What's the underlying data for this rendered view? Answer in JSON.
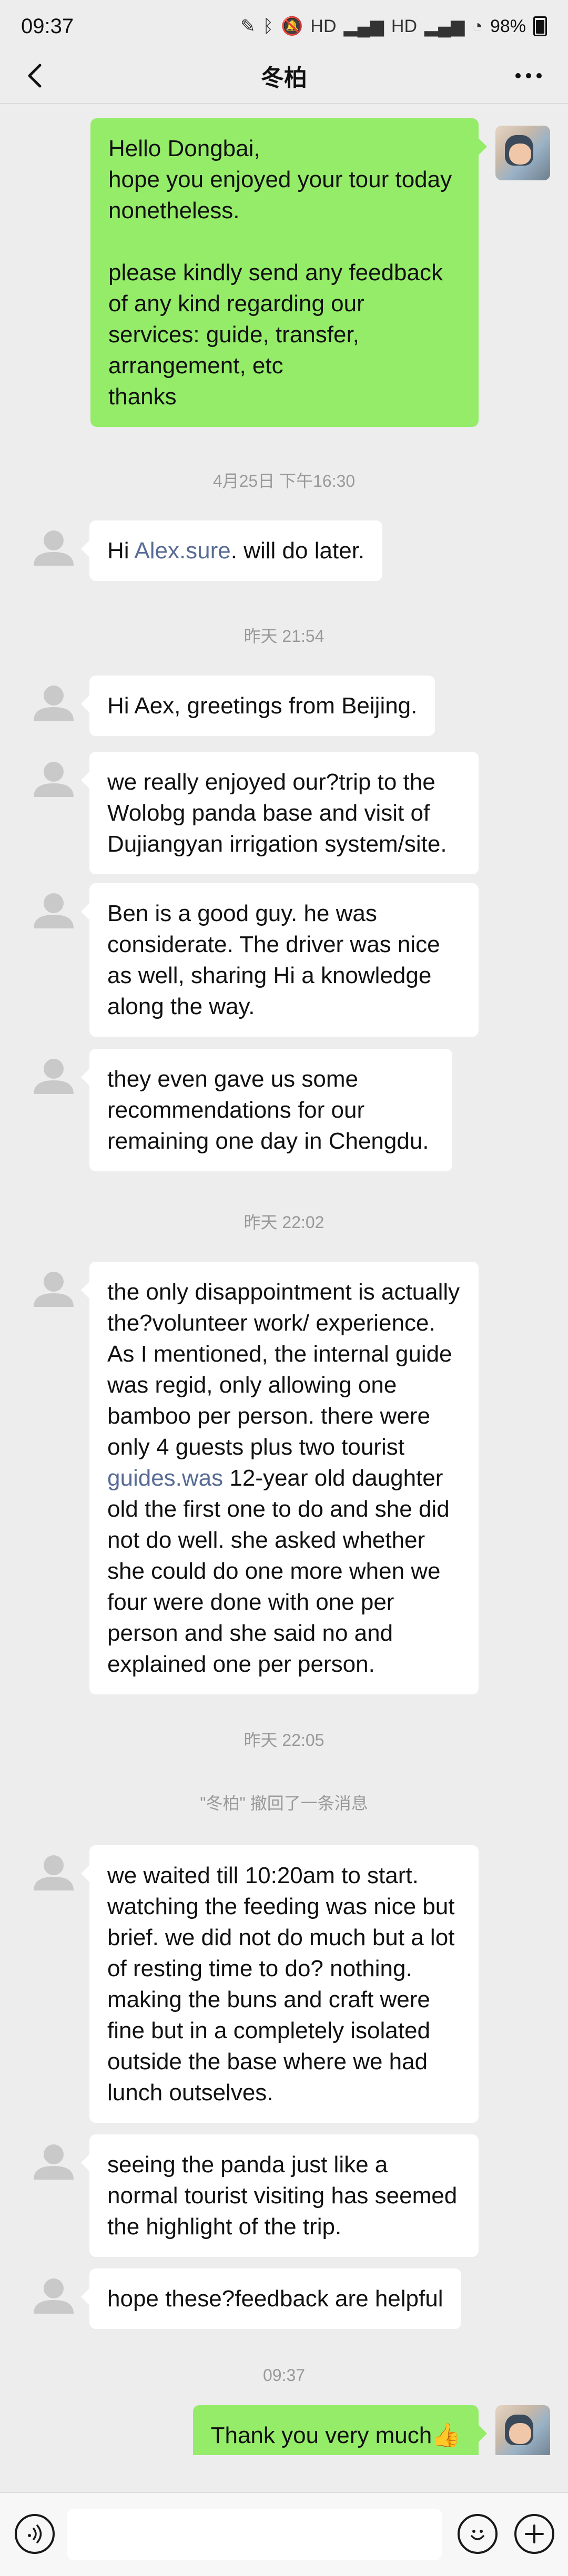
{
  "status_bar": {
    "time": "09:37",
    "battery": "98%",
    "icons": [
      "pen-icon",
      "bluetooth-icon",
      "mute-icon",
      "hd-signal-icon",
      "5g-signal-icon",
      "hd-signal-icon",
      "5g-signal-icon",
      "wifi-icon"
    ]
  },
  "header": {
    "title": "冬柏"
  },
  "timestamps": {
    "t1": "4月25日 下午16:30",
    "t2": "昨天 21:54",
    "t3": "昨天 22:02",
    "t4": "昨天 22:05",
    "t5": "09:37"
  },
  "system_notes": {
    "recall": "\"冬柏\" 撤回了一条消息"
  },
  "messages": {
    "m1": "Hello Dongbai,\nhope you enjoyed your tour today nonetheless.\n\nplease kindly send any feedback of any kind regarding our services: guide, transfer, arrangement, etc\nthanks",
    "m2_prefix": "Hi ",
    "m2_link": "Alex.sure",
    "m2_suffix": ". will do later.",
    "m3": "Hi Aex, greetings from Beijing.",
    "m4": "we really enjoyed our?trip to the Wolobg panda base and visit of Dujiangyan irrigation system/site.",
    "m5": "Ben is a good guy. he was considerate. The driver was nice as well, sharing Hi a knowledge along the way.",
    "m6": "they even gave us some recommendations for our remaining one day in Chengdu.",
    "m7_prefix": "the only disappointment is actually the?volunteer work/ experience. As I mentioned, the internal guide was regid, only allowing one bamboo per person. there were only 4 guests plus two tourist ",
    "m7_link": "guides.was",
    "m7_suffix": " 12-year old daughter old the first one to do and she did not do well. she asked whether she could do one more when we four were done with one per person and she said no and explained one per person.",
    "m8": "we waited till 10:20am to start. watching the feeding was nice but brief. we did not do much but a lot of resting time to do? nothing. making the buns and craft were fine but in a completely isolated outside the base where we had lunch outselves.",
    "m9": "seeing the panda just like a normal tourist visiting has seemed the highlight of the trip.",
    "m10": "hope these?feedback are helpful",
    "m11": "Thank you very much👍"
  },
  "input": {
    "placeholder": ""
  },
  "colors": {
    "background": "#ededed",
    "outgoing_bubble": "#95ec69",
    "incoming_bubble": "#ffffff",
    "link": "#576b95"
  }
}
